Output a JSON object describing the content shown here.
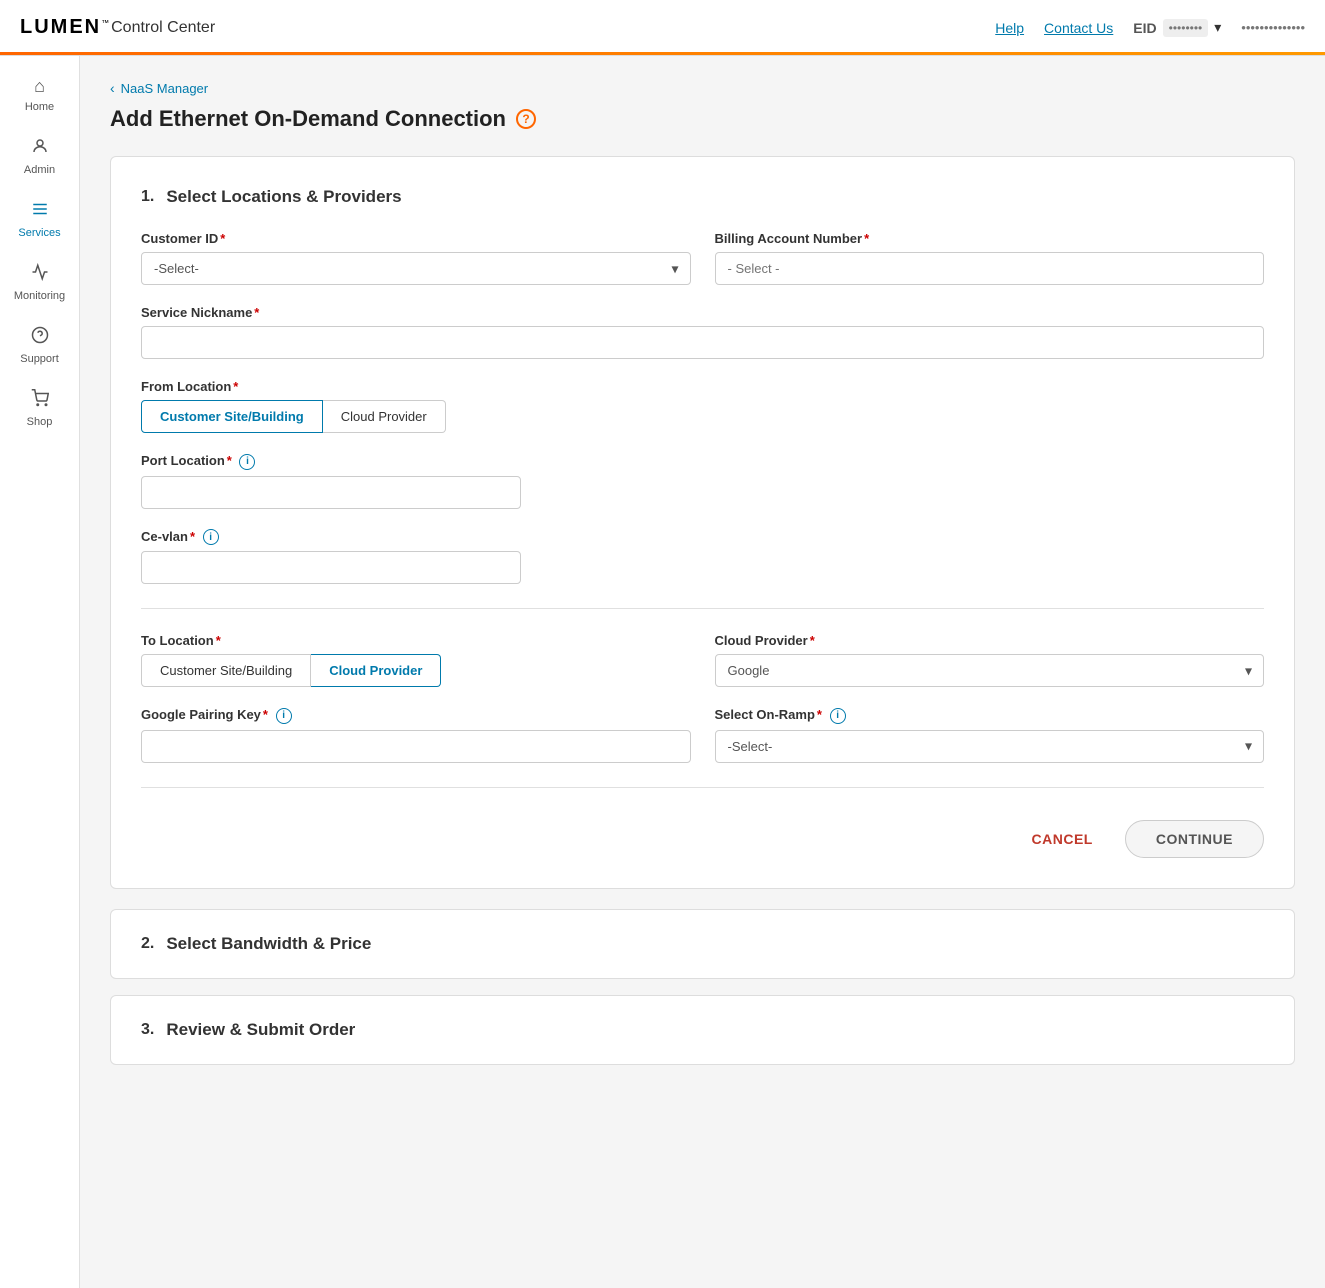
{
  "topbar": {
    "logo": "LUMEN",
    "logo_tm": "™",
    "app_title": "Control Center",
    "help_link": "Help",
    "contact_link": "Contact Us",
    "eid_label": "EID",
    "eid_value": "••••••••",
    "user_name": "••••••••••••••"
  },
  "sidebar": {
    "items": [
      {
        "id": "home",
        "label": "Home",
        "icon": "⌂"
      },
      {
        "id": "admin",
        "label": "Admin",
        "icon": "👤"
      },
      {
        "id": "services",
        "label": "Services",
        "icon": "≡"
      },
      {
        "id": "monitoring",
        "label": "Monitoring",
        "icon": "📈"
      },
      {
        "id": "support",
        "label": "Support",
        "icon": "🛠"
      },
      {
        "id": "shop",
        "label": "Shop",
        "icon": "🛒"
      }
    ]
  },
  "breadcrumb": {
    "back_arrow": "‹",
    "link_text": "NaaS Manager"
  },
  "page": {
    "title": "Add Ethernet On-Demand Connection",
    "help_icon": "?"
  },
  "steps": [
    {
      "number": "1.",
      "title": "Select Locations & Providers",
      "expanded": true
    },
    {
      "number": "2.",
      "title": "Select Bandwidth & Price",
      "expanded": false
    },
    {
      "number": "3.",
      "title": "Review & Submit Order",
      "expanded": false
    }
  ],
  "form": {
    "customer_id": {
      "label": "Customer ID",
      "required": true,
      "placeholder": "-Select-",
      "value": "-Select-"
    },
    "billing_account": {
      "label": "Billing Account Number",
      "required": true,
      "placeholder": "- Select -",
      "value": "- Select -"
    },
    "service_nickname": {
      "label": "Service Nickname",
      "required": true,
      "placeholder": "",
      "value": ""
    },
    "from_location": {
      "label": "From Location",
      "required": true,
      "options": [
        {
          "id": "customer-site",
          "label": "Customer Site/Building",
          "active": true
        },
        {
          "id": "cloud-provider",
          "label": "Cloud Provider",
          "active": false
        }
      ]
    },
    "port_location": {
      "label": "Port Location",
      "required": true,
      "has_info": true,
      "value": ""
    },
    "ce_vlan": {
      "label": "Ce-vlan",
      "required": true,
      "has_info": true,
      "value": ""
    },
    "to_location": {
      "label": "To Location",
      "required": true,
      "options": [
        {
          "id": "customer-site-to",
          "label": "Customer Site/Building",
          "active": false
        },
        {
          "id": "cloud-provider-to",
          "label": "Cloud Provider",
          "active": true
        }
      ]
    },
    "cloud_provider": {
      "label": "Cloud Provider",
      "required": true,
      "value": "Google"
    },
    "google_pairing_key": {
      "label": "Google Pairing Key",
      "required": true,
      "has_info": true,
      "value": ""
    },
    "select_on_ramp": {
      "label": "Select On-Ramp",
      "required": true,
      "has_info": true,
      "placeholder": "-Select-",
      "value": "-Select-"
    },
    "cancel_label": "CANCEL",
    "continue_label": "CONTINUE"
  },
  "icons": {
    "chevron_down": "▾",
    "back_arrow": "‹",
    "info": "i",
    "question": "?"
  }
}
